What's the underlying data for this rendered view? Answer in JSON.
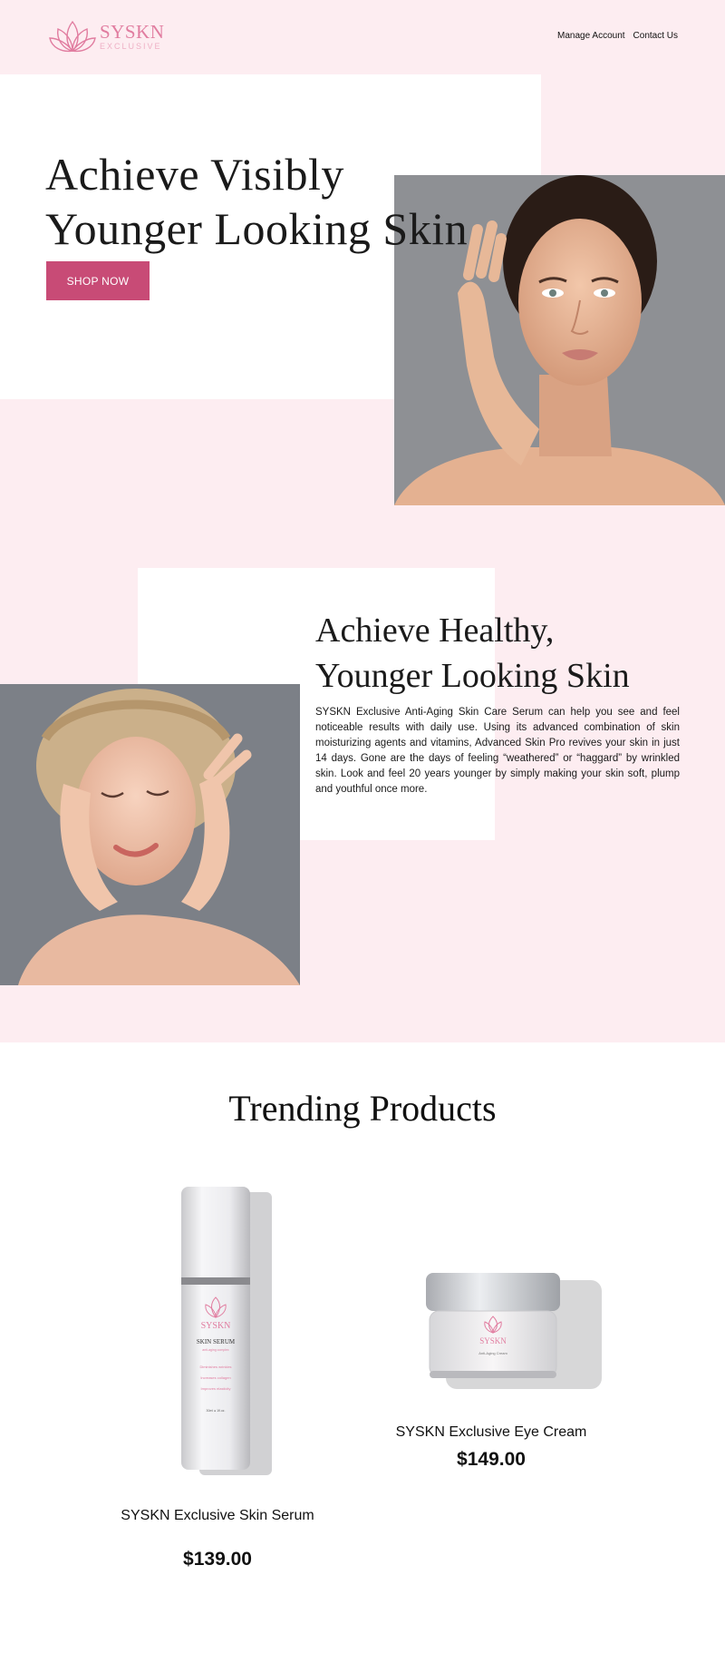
{
  "brand": {
    "name": "SYSKN",
    "tagline": "EXCLUSIVE"
  },
  "nav": {
    "items": [
      "Manage Account",
      "Contact Us"
    ]
  },
  "hero": {
    "title_line1": "Achieve Visibly",
    "title_line2": "Younger Looking Skin",
    "cta_label": "SHOP NOW"
  },
  "section2": {
    "title_line1": "Achieve Healthy,",
    "title_line2": "Younger Looking Skin",
    "body": "SYSKN Exclusive Anti-Aging Skin Care Serum can help you see and feel noticeable results with daily use. Using its advanced combination of skin moisturizing agents and vitamins, Advanced Skin Pro revives your skin in just 14 days. Gone are the days of feeling “weathered” or “haggard” by wrinkled skin. Look and feel 20 years younger by simply making your skin soft, plump and youthful once more."
  },
  "trending": {
    "title": "Trending Products",
    "products": [
      {
        "name": "SYSKN Exclusive Skin Serum",
        "price": "$139.00",
        "label_title": "SKIN SERUM",
        "label_sub": "anti-aging complex",
        "label_lines": [
          "Diminishes wrinkles",
          "Increases collagen",
          "Improves elasticity"
        ],
        "label_volume": "30ml ● 1fl.oz."
      },
      {
        "name": "SYSKN Exclusive Eye Cream",
        "price": "$149.00",
        "label_sub": "Anti-Aging Cream"
      }
    ]
  },
  "colors": {
    "pink_bg": "#fdedf1",
    "accent": "#c84b76",
    "logo": "#e17da0"
  },
  "icons": [
    "lotus-logo-icon"
  ]
}
